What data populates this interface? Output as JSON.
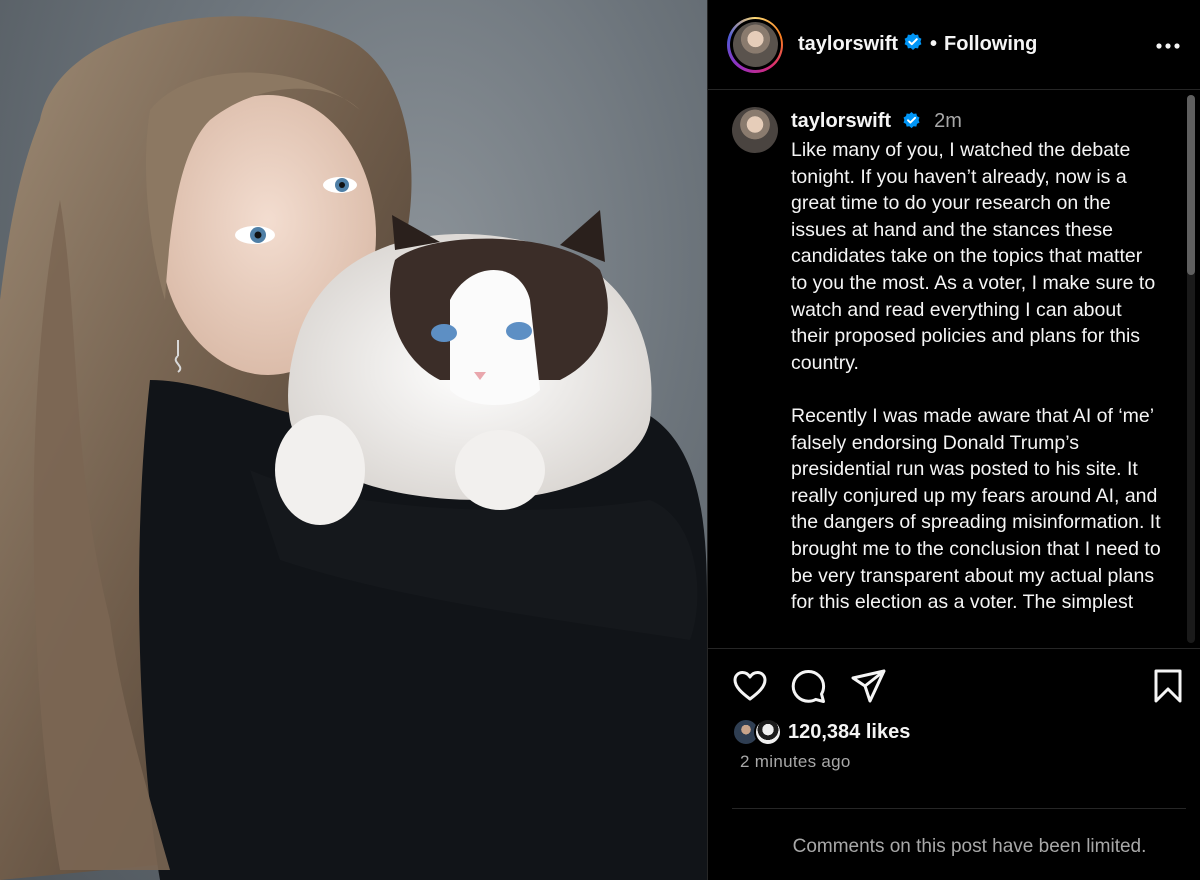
{
  "header": {
    "username": "taylorswift",
    "separator": "•",
    "follow_status": "Following"
  },
  "caption": {
    "username": "taylorswift",
    "time": "2m",
    "text": "Like many of you, I watched the debate tonight. If you haven’t already, now is a great time to do your research on the issues at hand and the stances these candidates take on the topics that matter to you the most. As a voter, I make sure to watch and read everything I can about their proposed policies and plans for this country.\n\nRecently I was made aware that AI of ‘me’ falsely endorsing Donald Trump’s presidential run was posted to his site. It really conjured up my fears around AI, and the dangers of spreading misinformation. It brought me to the conclusion that I need to be very transparent about my actual plans for this election as a voter. The simplest"
  },
  "engagement": {
    "likes": "120,384 likes",
    "posted": "2 minutes ago"
  },
  "comments": {
    "notice": "Comments on this post have been limited."
  },
  "colors": {
    "background": "#000000",
    "text": "#f5f5f5",
    "secondary_text": "#a8a8a8",
    "verified_blue": "#0095f6",
    "divider": "#262626"
  },
  "icons": [
    "verified-badge-icon",
    "more-options-icon",
    "heart-icon",
    "comment-icon",
    "share-icon",
    "bookmark-icon"
  ]
}
